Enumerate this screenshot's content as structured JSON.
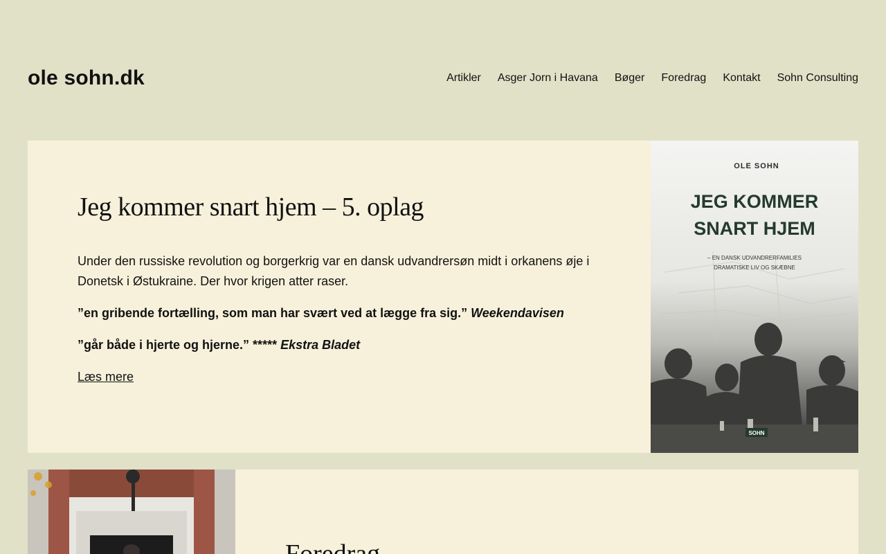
{
  "header": {
    "site_title": "ole sohn.dk",
    "nav": [
      "Artikler",
      "Asger Jorn i Havana",
      "Bøger",
      "Foredrag",
      "Kontakt",
      "Sohn Consulting"
    ]
  },
  "post1": {
    "title": "Jeg kommer snart hjem – 5. oplag",
    "intro": "Under den russiske revolution og borgerkrig var en dansk udvandrersøn midt i orkanens øje i Donetsk i Østukraine. Der hvor krigen atter raser.",
    "quote1": "”en gribende fortælling, som man har svært ved at lægge fra sig.” ",
    "quote1_source": "Weekendavisen",
    "quote2": "”går både i hjerte og hjerne.” ***** ",
    "quote2_source": "Ekstra Bladet",
    "read_more": "Læs mere",
    "cover": {
      "author": "OLE SOHN",
      "title_line1": "JEG KOMMER",
      "title_line2": "SNART HJEM",
      "subtitle_line1": "– EN DANSK UDVANDRERFAMILIES",
      "subtitle_line2": "DRAMATISKE LIV OG SKÆBNE",
      "publisher": "SOHN"
    }
  },
  "post2": {
    "title": "Foredrag"
  },
  "colors": {
    "background": "#e1e1c8",
    "card": "#f7f1db",
    "text": "#111111"
  }
}
